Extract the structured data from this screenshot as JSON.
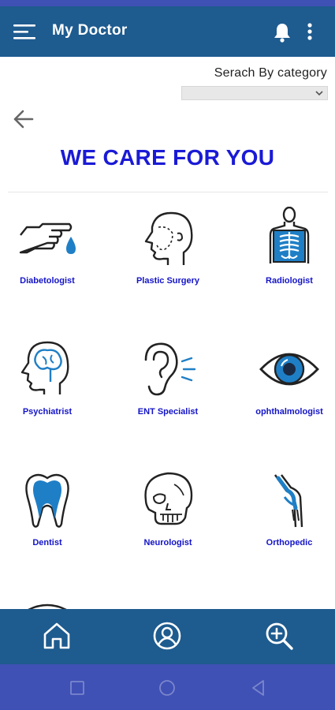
{
  "app": {
    "title": "My Doctor"
  },
  "search": {
    "label": "Serach By category",
    "selected": ""
  },
  "headline": "WE CARE FOR YOU",
  "specialists": [
    {
      "label": "Diabetologist",
      "icon": "hand-drop-icon"
    },
    {
      "label": "Plastic Surgery",
      "icon": "face-profile-icon"
    },
    {
      "label": "Radiologist",
      "icon": "xray-icon"
    },
    {
      "label": "Psychiatrist",
      "icon": "brain-head-icon"
    },
    {
      "label": "ENT Specialist",
      "icon": "ear-icon"
    },
    {
      "label": "ophthalmologist",
      "icon": "eye-icon"
    },
    {
      "label": "Dentist",
      "icon": "tooth-icon"
    },
    {
      "label": "Neurologist",
      "icon": "skull-icon"
    },
    {
      "label": "Orthopedic",
      "icon": "knee-joint-icon"
    }
  ],
  "bottom_nav": [
    {
      "icon": "home-icon"
    },
    {
      "icon": "profile-icon"
    },
    {
      "icon": "zoom-search-icon"
    }
  ],
  "colors": {
    "app_bar": "#1e5b8f",
    "accent_text": "#1a1ad6",
    "system_bar": "#3f51b5",
    "icon_blue": "#1f7fc6"
  }
}
